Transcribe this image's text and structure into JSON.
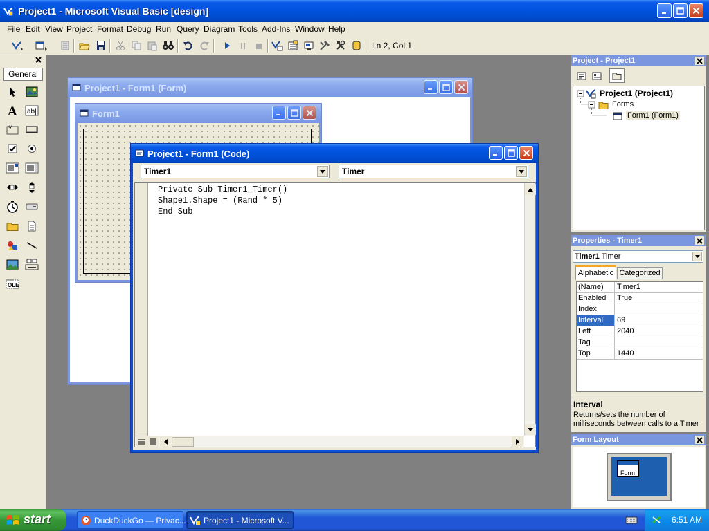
{
  "window": {
    "title": "Project1 - Microsoft Visual Basic [design]"
  },
  "menu": [
    "File",
    "Edit",
    "View",
    "Project",
    "Format",
    "Debug",
    "Run",
    "Query",
    "Diagram",
    "Tools",
    "Add-Ins",
    "Window",
    "Help"
  ],
  "toolbar": {
    "position": "Ln 2, Col 1"
  },
  "toolbox": {
    "tab": "General"
  },
  "form_designer": {
    "title": "Project1 - Form1 (Form)",
    "inner_title": "Form1"
  },
  "code_window": {
    "title": "Project1 - Form1 (Code)",
    "object_combo": "Timer1",
    "proc_combo": "Timer",
    "lines": [
      "Private Sub Timer1_Timer()",
      "Shape1.Shape = (Rand * 5)",
      "End Sub"
    ]
  },
  "project_explorer": {
    "title": "Project - Project1",
    "root": "Project1 (Project1)",
    "folder": "Forms",
    "item": "Form1 (Form1)"
  },
  "properties": {
    "title": "Properties - Timer1",
    "object_name": "Timer1",
    "object_type": "Timer",
    "tab_alpha": "Alphabetic",
    "tab_cat": "Categorized",
    "rows": [
      {
        "name": "(Name)",
        "value": "Timer1"
      },
      {
        "name": "Enabled",
        "value": "True"
      },
      {
        "name": "Index",
        "value": ""
      },
      {
        "name": "Interval",
        "value": "69"
      },
      {
        "name": "Left",
        "value": "2040"
      },
      {
        "name": "Tag",
        "value": ""
      },
      {
        "name": "Top",
        "value": "1440"
      }
    ],
    "desc_title": "Interval",
    "desc_line1": "Returns/sets the number of",
    "desc_line2": "milliseconds between calls to a Timer"
  },
  "form_layout": {
    "title": "Form Layout",
    "mini_label": "Form"
  },
  "taskbar": {
    "start": "start",
    "tasks": [
      "DuckDuckGo — Privac...",
      "Project1 - Microsoft V..."
    ],
    "clock": "6:51 AM"
  },
  "colors": {
    "xp_blue": "#0052dd",
    "face": "#ece9d8",
    "mdi": "#808080",
    "start_green": "#3c9c3c"
  }
}
